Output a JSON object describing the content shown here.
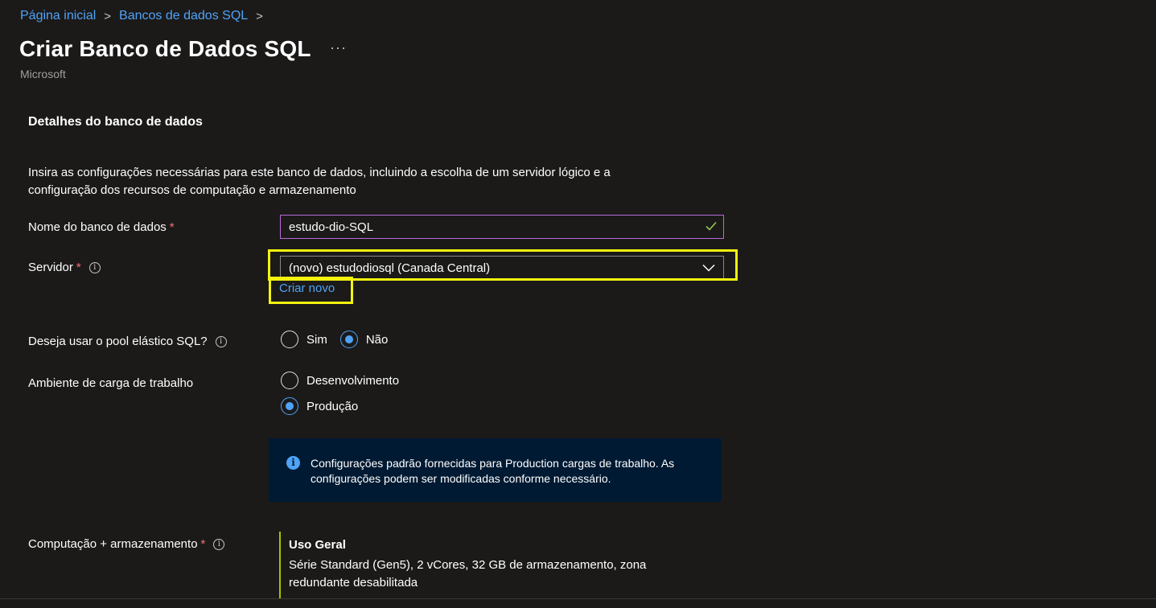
{
  "breadcrumb": {
    "items": [
      "Página inicial",
      "Bancos de dados SQL"
    ],
    "separator": ">"
  },
  "header": {
    "title": "Criar Banco de Dados SQL",
    "more": "···",
    "subtitle": "Microsoft"
  },
  "section": {
    "title": "Detalhes do banco de dados",
    "description": "Insira as configurações necessárias para este banco de dados, incluindo a escolha de um servidor lógico e a configuração dos recursos de computação e armazenamento"
  },
  "fields": {
    "database_name": {
      "label": "Nome do banco de dados",
      "required": "*",
      "value": "estudo-dio-SQL"
    },
    "server": {
      "label": "Servidor",
      "required": "*",
      "value": "(novo) estudodiosql (Canada Central)",
      "create_new": "Criar novo"
    },
    "elastic_pool": {
      "label": "Deseja usar o pool elástico SQL?",
      "options": [
        "Sim",
        "Não"
      ],
      "selected": "Não"
    },
    "workload": {
      "label": "Ambiente de carga de trabalho",
      "options": [
        "Desenvolvimento",
        "Produção"
      ],
      "selected": "Produção"
    },
    "compute": {
      "label": "Computação + armazenamento",
      "required": "*",
      "tier": "Uso Geral",
      "detail": "Série Standard (Gen5), 2 vCores, 32 GB de armazenamento, zona redundante desabilitada"
    }
  },
  "info_banner": {
    "text": "Configurações padrão fornecidas para Production cargas de trabalho. As configurações podem ser modificadas conforme necessário."
  },
  "icons": {
    "info": "i",
    "checkmark": "check-icon",
    "chevron": "chevron-down-icon"
  },
  "colors": {
    "background": "#1b1a19",
    "link": "#4fa3f7",
    "required": "#f1707b",
    "highlight": "#f3f30f",
    "valid": "#92c353",
    "banner": "#001a33",
    "compute_accent": "#a4c400"
  }
}
